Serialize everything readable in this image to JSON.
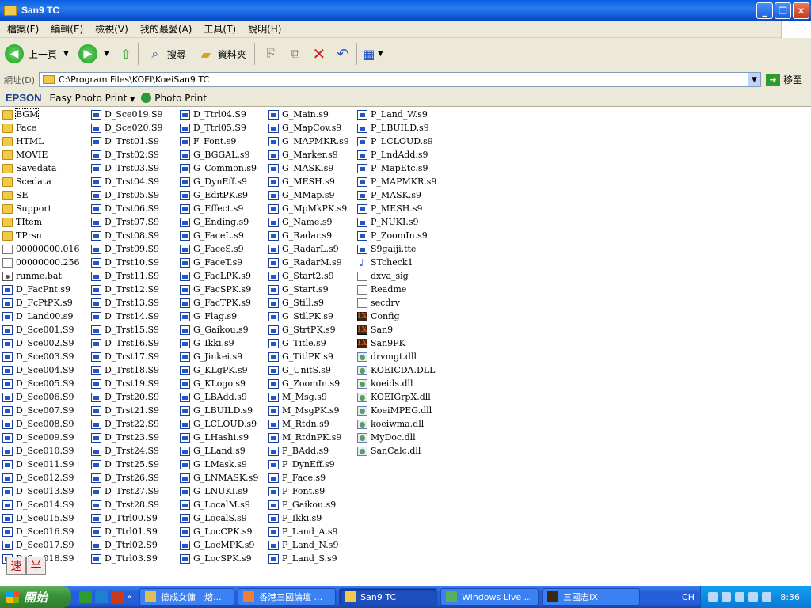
{
  "window": {
    "title": "San9  TC"
  },
  "menu": [
    "檔案(F)",
    "編輯(E)",
    "檢視(V)",
    "我的最愛(A)",
    "工具(T)",
    "說明(H)"
  ],
  "toolbar": {
    "back": "上一頁",
    "search": "搜尋",
    "folders": "資料夾"
  },
  "address": {
    "label": "網址(D)",
    "path": "C:\\Program Files\\KOEI\\KoeiSan9 TC",
    "go": "移至"
  },
  "epson": {
    "brand": "EPSON",
    "easy_photo_print": "Easy Photo Print",
    "photo_print": "Photo Print"
  },
  "columns": [
    [
      {
        "n": "BGM",
        "t": "folder",
        "sel": true
      },
      {
        "n": "Face",
        "t": "folder"
      },
      {
        "n": "HTML",
        "t": "folder"
      },
      {
        "n": "MOVIE",
        "t": "folder"
      },
      {
        "n": "Savedata",
        "t": "folder"
      },
      {
        "n": "Scedata",
        "t": "folder"
      },
      {
        "n": "SE",
        "t": "folder"
      },
      {
        "n": "Support",
        "t": "folder"
      },
      {
        "n": "TItem",
        "t": "folder"
      },
      {
        "n": "TPrsn",
        "t": "folder"
      },
      {
        "n": "00000000.016",
        "t": "file"
      },
      {
        "n": "00000000.256",
        "t": "file"
      },
      {
        "n": "runme.bat",
        "t": "bat"
      },
      {
        "n": "D_FacPnt.s9",
        "t": "s9"
      },
      {
        "n": "D_FcPtPK.s9",
        "t": "s9"
      },
      {
        "n": "D_Land00.s9",
        "t": "s9"
      },
      {
        "n": "D_Sce001.S9",
        "t": "s9"
      },
      {
        "n": "D_Sce002.S9",
        "t": "s9"
      },
      {
        "n": "D_Sce003.S9",
        "t": "s9"
      },
      {
        "n": "D_Sce004.S9",
        "t": "s9"
      },
      {
        "n": "D_Sce005.S9",
        "t": "s9"
      },
      {
        "n": "D_Sce006.S9",
        "t": "s9"
      },
      {
        "n": "D_Sce007.S9",
        "t": "s9"
      },
      {
        "n": "D_Sce008.S9",
        "t": "s9"
      },
      {
        "n": "D_Sce009.S9",
        "t": "s9"
      },
      {
        "n": "D_Sce010.S9",
        "t": "s9"
      },
      {
        "n": "D_Sce011.S9",
        "t": "s9"
      },
      {
        "n": "D_Sce012.S9",
        "t": "s9"
      },
      {
        "n": "D_Sce013.S9",
        "t": "s9"
      },
      {
        "n": "D_Sce014.S9",
        "t": "s9"
      },
      {
        "n": "D_Sce015.S9",
        "t": "s9"
      },
      {
        "n": "D_Sce016.S9",
        "t": "s9"
      },
      {
        "n": "D_Sce017.S9",
        "t": "s9"
      },
      {
        "n": "D_Sce018.S9",
        "t": "s9"
      }
    ],
    [
      {
        "n": "D_Sce019.S9",
        "t": "s9"
      },
      {
        "n": "D_Sce020.S9",
        "t": "s9"
      },
      {
        "n": "D_Trst01.S9",
        "t": "s9"
      },
      {
        "n": "D_Trst02.S9",
        "t": "s9"
      },
      {
        "n": "D_Trst03.S9",
        "t": "s9"
      },
      {
        "n": "D_Trst04.S9",
        "t": "s9"
      },
      {
        "n": "D_Trst05.S9",
        "t": "s9"
      },
      {
        "n": "D_Trst06.S9",
        "t": "s9"
      },
      {
        "n": "D_Trst07.S9",
        "t": "s9"
      },
      {
        "n": "D_Trst08.S9",
        "t": "s9"
      },
      {
        "n": "D_Trst09.S9",
        "t": "s9"
      },
      {
        "n": "D_Trst10.S9",
        "t": "s9"
      },
      {
        "n": "D_Trst11.S9",
        "t": "s9"
      },
      {
        "n": "D_Trst12.S9",
        "t": "s9"
      },
      {
        "n": "D_Trst13.S9",
        "t": "s9"
      },
      {
        "n": "D_Trst14.S9",
        "t": "s9"
      },
      {
        "n": "D_Trst15.S9",
        "t": "s9"
      },
      {
        "n": "D_Trst16.S9",
        "t": "s9"
      },
      {
        "n": "D_Trst17.S9",
        "t": "s9"
      },
      {
        "n": "D_Trst18.S9",
        "t": "s9"
      },
      {
        "n": "D_Trst19.S9",
        "t": "s9"
      },
      {
        "n": "D_Trst20.S9",
        "t": "s9"
      },
      {
        "n": "D_Trst21.S9",
        "t": "s9"
      },
      {
        "n": "D_Trst22.S9",
        "t": "s9"
      },
      {
        "n": "D_Trst23.S9",
        "t": "s9"
      },
      {
        "n": "D_Trst24.S9",
        "t": "s9"
      },
      {
        "n": "D_Trst25.S9",
        "t": "s9"
      },
      {
        "n": "D_Trst26.S9",
        "t": "s9"
      },
      {
        "n": "D_Trst27.S9",
        "t": "s9"
      },
      {
        "n": "D_Trst28.S9",
        "t": "s9"
      },
      {
        "n": "D_Ttrl00.S9",
        "t": "s9"
      },
      {
        "n": "D_Ttrl01.S9",
        "t": "s9"
      },
      {
        "n": "D_Ttrl02.S9",
        "t": "s9"
      },
      {
        "n": "D_Ttrl03.S9",
        "t": "s9"
      }
    ],
    [
      {
        "n": "D_Ttrl04.S9",
        "t": "s9"
      },
      {
        "n": "D_Ttrl05.S9",
        "t": "s9"
      },
      {
        "n": "F_Font.s9",
        "t": "s9"
      },
      {
        "n": "G_BGGAL.s9",
        "t": "s9"
      },
      {
        "n": "G_Common.s9",
        "t": "s9"
      },
      {
        "n": "G_DynEff.s9",
        "t": "s9"
      },
      {
        "n": "G_EditPK.s9",
        "t": "s9"
      },
      {
        "n": "G_Effect.s9",
        "t": "s9"
      },
      {
        "n": "G_Ending.s9",
        "t": "s9"
      },
      {
        "n": "G_FaceL.s9",
        "t": "s9"
      },
      {
        "n": "G_FaceS.s9",
        "t": "s9"
      },
      {
        "n": "G_FaceT.s9",
        "t": "s9"
      },
      {
        "n": "G_FacLPK.s9",
        "t": "s9"
      },
      {
        "n": "G_FacSPK.s9",
        "t": "s9"
      },
      {
        "n": "G_FacTPK.s9",
        "t": "s9"
      },
      {
        "n": "G_Flag.s9",
        "t": "s9"
      },
      {
        "n": "G_Gaikou.s9",
        "t": "s9"
      },
      {
        "n": "G_Ikki.s9",
        "t": "s9"
      },
      {
        "n": "G_Jinkei.s9",
        "t": "s9"
      },
      {
        "n": "G_KLgPK.s9",
        "t": "s9"
      },
      {
        "n": "G_KLogo.s9",
        "t": "s9"
      },
      {
        "n": "G_LBAdd.s9",
        "t": "s9"
      },
      {
        "n": "G_LBUILD.s9",
        "t": "s9"
      },
      {
        "n": "G_LCLOUD.s9",
        "t": "s9"
      },
      {
        "n": "G_LHashi.s9",
        "t": "s9"
      },
      {
        "n": "G_LLand.s9",
        "t": "s9"
      },
      {
        "n": "G_LMask.s9",
        "t": "s9"
      },
      {
        "n": "G_LNMASK.s9",
        "t": "s9"
      },
      {
        "n": "G_LNUKI.s9",
        "t": "s9"
      },
      {
        "n": "G_LocalM.s9",
        "t": "s9"
      },
      {
        "n": "G_LocalS.s9",
        "t": "s9"
      },
      {
        "n": "G_LocCPK.s9",
        "t": "s9"
      },
      {
        "n": "G_LocMPK.s9",
        "t": "s9"
      },
      {
        "n": "G_LocSPK.s9",
        "t": "s9"
      }
    ],
    [
      {
        "n": "G_Main.s9",
        "t": "s9"
      },
      {
        "n": "G_MapCov.s9",
        "t": "s9"
      },
      {
        "n": "G_MAPMKR.s9",
        "t": "s9"
      },
      {
        "n": "G_Marker.s9",
        "t": "s9"
      },
      {
        "n": "G_MASK.s9",
        "t": "s9"
      },
      {
        "n": "G_MESH.s9",
        "t": "s9"
      },
      {
        "n": "G_MMap.s9",
        "t": "s9"
      },
      {
        "n": "G_MpMkPK.s9",
        "t": "s9"
      },
      {
        "n": "G_Name.s9",
        "t": "s9"
      },
      {
        "n": "G_Radar.s9",
        "t": "s9"
      },
      {
        "n": "G_RadarL.s9",
        "t": "s9"
      },
      {
        "n": "G_RadarM.s9",
        "t": "s9"
      },
      {
        "n": "G_Start2.s9",
        "t": "s9"
      },
      {
        "n": "G_Start.s9",
        "t": "s9"
      },
      {
        "n": "G_Still.s9",
        "t": "s9"
      },
      {
        "n": "G_StllPK.s9",
        "t": "s9"
      },
      {
        "n": "G_StrtPK.s9",
        "t": "s9"
      },
      {
        "n": "G_Title.s9",
        "t": "s9"
      },
      {
        "n": "G_TitlPK.s9",
        "t": "s9"
      },
      {
        "n": "G_UnitS.s9",
        "t": "s9"
      },
      {
        "n": "G_ZoomIn.s9",
        "t": "s9"
      },
      {
        "n": "M_Msg.s9",
        "t": "s9"
      },
      {
        "n": "M_MsgPK.s9",
        "t": "s9"
      },
      {
        "n": "M_Rtdn.s9",
        "t": "s9"
      },
      {
        "n": "M_RtdnPK.s9",
        "t": "s9"
      },
      {
        "n": "P_BAdd.s9",
        "t": "s9"
      },
      {
        "n": "P_DynEff.s9",
        "t": "s9"
      },
      {
        "n": "P_Face.s9",
        "t": "s9"
      },
      {
        "n": "P_Font.s9",
        "t": "s9"
      },
      {
        "n": "P_Gaikou.s9",
        "t": "s9"
      },
      {
        "n": "P_Ikki.s9",
        "t": "s9"
      },
      {
        "n": "P_Land_A.s9",
        "t": "s9"
      },
      {
        "n": "P_Land_N.s9",
        "t": "s9"
      },
      {
        "n": "P_Land_S.s9",
        "t": "s9"
      }
    ],
    [
      {
        "n": "P_Land_W.s9",
        "t": "s9"
      },
      {
        "n": "P_LBUILD.s9",
        "t": "s9"
      },
      {
        "n": "P_LCLOUD.s9",
        "t": "s9"
      },
      {
        "n": "P_LndAdd.s9",
        "t": "s9"
      },
      {
        "n": "P_MapEtc.s9",
        "t": "s9"
      },
      {
        "n": "P_MAPMKR.s9",
        "t": "s9"
      },
      {
        "n": "P_MASK.s9",
        "t": "s9"
      },
      {
        "n": "P_MESH.s9",
        "t": "s9"
      },
      {
        "n": "P_NUKI.s9",
        "t": "s9"
      },
      {
        "n": "P_ZoomIn.s9",
        "t": "s9"
      },
      {
        "n": "S9gaiji.tte",
        "t": "s9"
      },
      {
        "n": "STcheck1",
        "t": "font"
      },
      {
        "n": "dxva_sig",
        "t": "file"
      },
      {
        "n": "Readme",
        "t": "file"
      },
      {
        "n": "secdrv",
        "t": "file"
      },
      {
        "n": "Config",
        "t": "app"
      },
      {
        "n": "San9",
        "t": "app"
      },
      {
        "n": "San9PK",
        "t": "app"
      },
      {
        "n": "drvmgt.dll",
        "t": "dll"
      },
      {
        "n": "KOEICDA.DLL",
        "t": "dll"
      },
      {
        "n": "koeids.dll",
        "t": "dll"
      },
      {
        "n": "KOEIGrpX.dll",
        "t": "dll"
      },
      {
        "n": "KoeiMPEG.dll",
        "t": "dll"
      },
      {
        "n": "koeiwma.dll",
        "t": "dll"
      },
      {
        "n": "MyDoc.dll",
        "t": "dll"
      },
      {
        "n": "SanCalc.dll",
        "t": "dll"
      }
    ]
  ],
  "ime": [
    "速",
    "半"
  ],
  "taskbar": {
    "start": "開始",
    "tasks": [
      "德成女傭　熔...",
      "香港三國論壇 ...",
      "San9 TC",
      "Windows Live ...",
      "三國志IX"
    ],
    "lang": "CH",
    "clock": "8:36"
  }
}
